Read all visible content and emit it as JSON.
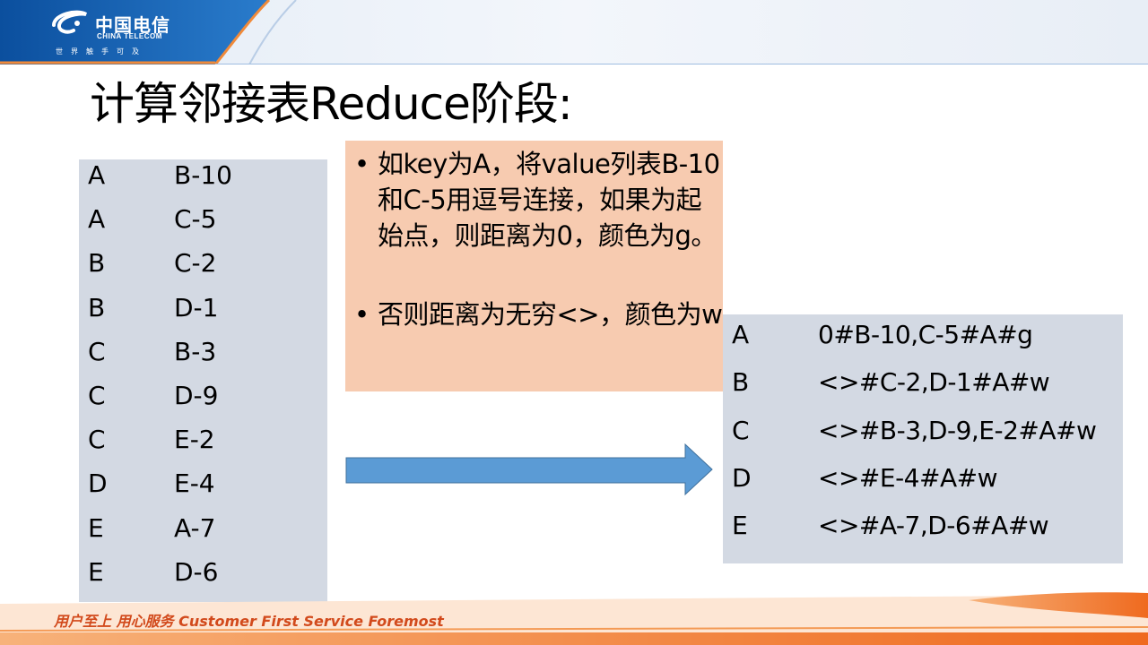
{
  "header": {
    "logo_cn": "中国电信",
    "logo_en": "CHINA TELECOM",
    "logo_slogan": "世界触手可及"
  },
  "title": "计算邻接表Reduce阶段:",
  "edge_table": [
    {
      "node": "A",
      "edge": "B-10"
    },
    {
      "node": "A",
      "edge": "C-5"
    },
    {
      "node": "B",
      "edge": "C-2"
    },
    {
      "node": "B",
      "edge": "D-1"
    },
    {
      "node": "C",
      "edge": "B-3"
    },
    {
      "node": "C",
      "edge": "D-9"
    },
    {
      "node": "C",
      "edge": "E-2"
    },
    {
      "node": "D",
      "edge": "E-4"
    },
    {
      "node": "E",
      "edge": "A-7"
    },
    {
      "node": "E",
      "edge": "D-6"
    }
  ],
  "notes": {
    "bullet_char": "•",
    "items": [
      "如key为A，将value列表B-10和C-5用逗号连接，如果为起始点，则距离为0，颜色为g。",
      "否则距离为无穷<>，颜色为w"
    ]
  },
  "result_table": [
    {
      "node": "A",
      "value": "0#B-10,C-5#A#g"
    },
    {
      "node": "B",
      "value": "<>#C-2,D-1#A#w"
    },
    {
      "node": "C",
      "value": "<>#B-3,D-9,E-2#A#w"
    },
    {
      "node": "D",
      "value": "<>#E-4#A#w"
    },
    {
      "node": "E",
      "value": "<>#A-7,D-6#A#w"
    }
  ],
  "footer": {
    "slogan": "用户至上 用心服务 Customer First Service Foremost"
  },
  "colors": {
    "banner_blue": "#1461b0",
    "box_gray": "#d3d9e3",
    "box_orange": "#f7cbb0",
    "arrow_blue": "#5b9bd5",
    "footer_orange": "#ef6a1f"
  }
}
